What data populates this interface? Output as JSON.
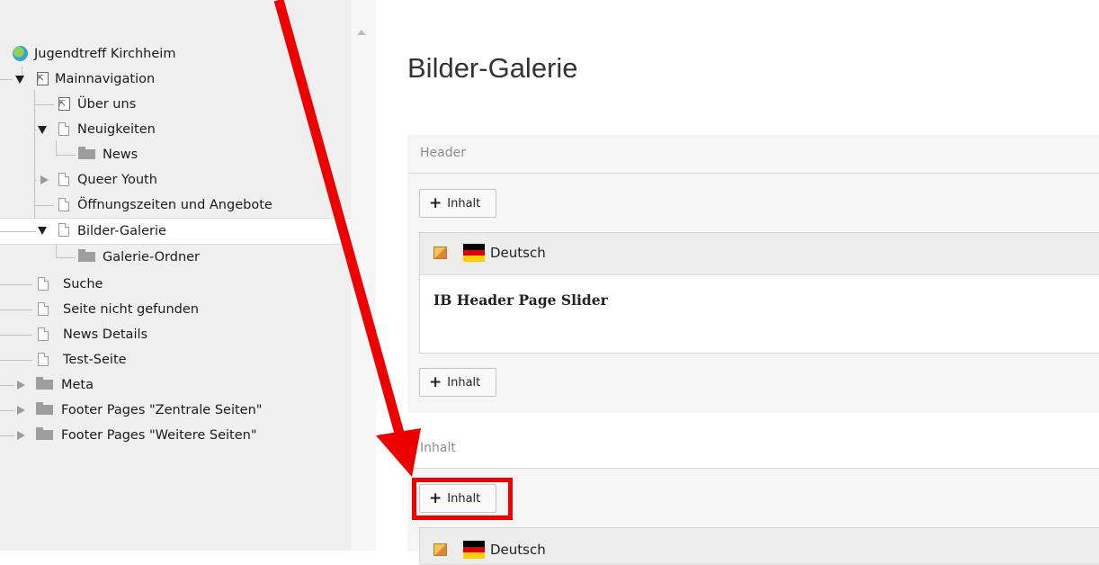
{
  "tree": {
    "root": "Jugendtreff Kirchheim",
    "items": [
      {
        "label": "Mainnavigation"
      },
      {
        "label": "Über uns"
      },
      {
        "label": "Neuigkeiten"
      },
      {
        "label": "News"
      },
      {
        "label": "Queer Youth"
      },
      {
        "label": "Öffnungszeiten und Angebote"
      },
      {
        "label": "Bilder-Galerie"
      },
      {
        "label": "Galerie-Ordner"
      },
      {
        "label": "Suche"
      },
      {
        "label": "Seite nicht gefunden"
      },
      {
        "label": "News Details"
      },
      {
        "label": "Test-Seite"
      },
      {
        "label": "Meta"
      },
      {
        "label": "Footer Pages \"Zentrale Seiten\""
      },
      {
        "label": "Footer Pages \"Weitere Seiten\""
      }
    ]
  },
  "main": {
    "title": "Bilder-Galerie",
    "header_column": {
      "label": "Header",
      "add_label": "Inhalt",
      "element": {
        "language": "Deutsch",
        "title": "IB Header Page Slider"
      },
      "add_label_2": "Inhalt"
    },
    "content_column": {
      "label": "Inhalt",
      "add_label": "Inhalt",
      "element": {
        "language": "Deutsch"
      }
    }
  },
  "colors": {
    "annotation": "#e00000",
    "flag": [
      "#000000",
      "#dd0000",
      "#ffce00"
    ]
  }
}
